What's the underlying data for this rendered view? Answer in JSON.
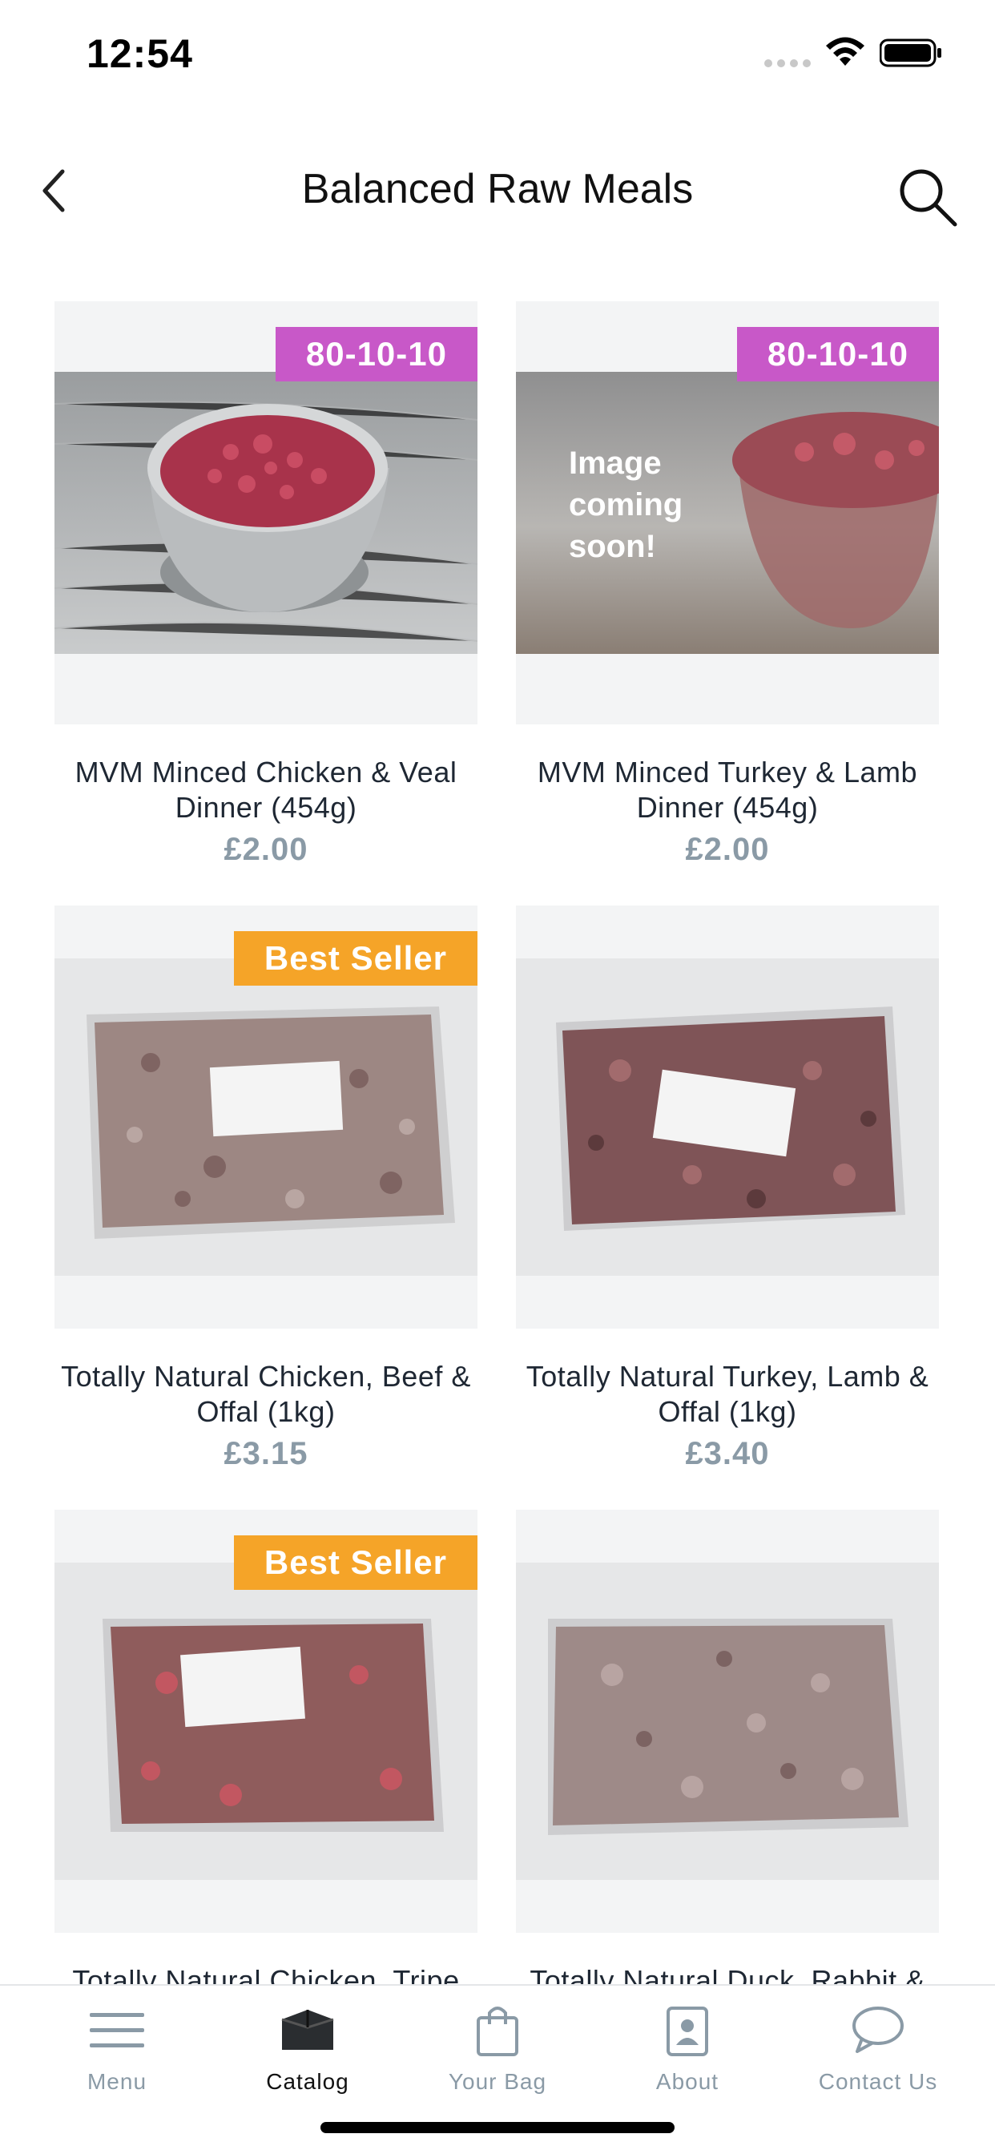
{
  "status_bar": {
    "time": "12:54"
  },
  "nav": {
    "title": "Balanced Raw Meals"
  },
  "products": [
    {
      "name": "MVM Minced Chicken & Veal Dinner (454g)",
      "price": "£2.00",
      "badge": "80-10-10",
      "badge_color": "#c858c8",
      "image_kind": "bowl-photo"
    },
    {
      "name": "MVM Minced Turkey & Lamb Dinner (454g)",
      "price": "£2.00",
      "badge": "80-10-10",
      "badge_color": "#c858c8",
      "image_kind": "placeholder-photo",
      "image_text": "Image coming soon!"
    },
    {
      "name": "Totally Natural Chicken, Beef & Offal (1kg)",
      "price": "£3.15",
      "badge": "Best Seller",
      "badge_color": "#f5a428",
      "image_kind": "bag-photo"
    },
    {
      "name": "Totally Natural Turkey, Lamb & Offal (1kg)",
      "price": "£3.40",
      "badge": "",
      "image_kind": "bag-photo"
    },
    {
      "name": "Totally Natural Chicken, Tripe",
      "price": "",
      "badge": "Best Seller",
      "badge_color": "#f5a428",
      "image_kind": "bag-photo"
    },
    {
      "name": "Totally Natural Duck, Rabbit &",
      "price": "",
      "badge": "",
      "image_kind": "bag-photo"
    }
  ],
  "tabs": [
    {
      "label": "Menu",
      "icon": "menu-icon",
      "active": false
    },
    {
      "label": "Catalog",
      "icon": "catalog-box-icon",
      "active": true
    },
    {
      "label": "Your Bag",
      "icon": "shopping-bag-icon",
      "active": false
    },
    {
      "label": "About",
      "icon": "contact-card-icon",
      "active": false
    },
    {
      "label": "Contact Us",
      "icon": "chat-bubble-icon",
      "active": false
    }
  ],
  "colors": {
    "accent_purple": "#c858c8",
    "accent_orange": "#f5a428",
    "price_grey": "#8a9aa6"
  }
}
